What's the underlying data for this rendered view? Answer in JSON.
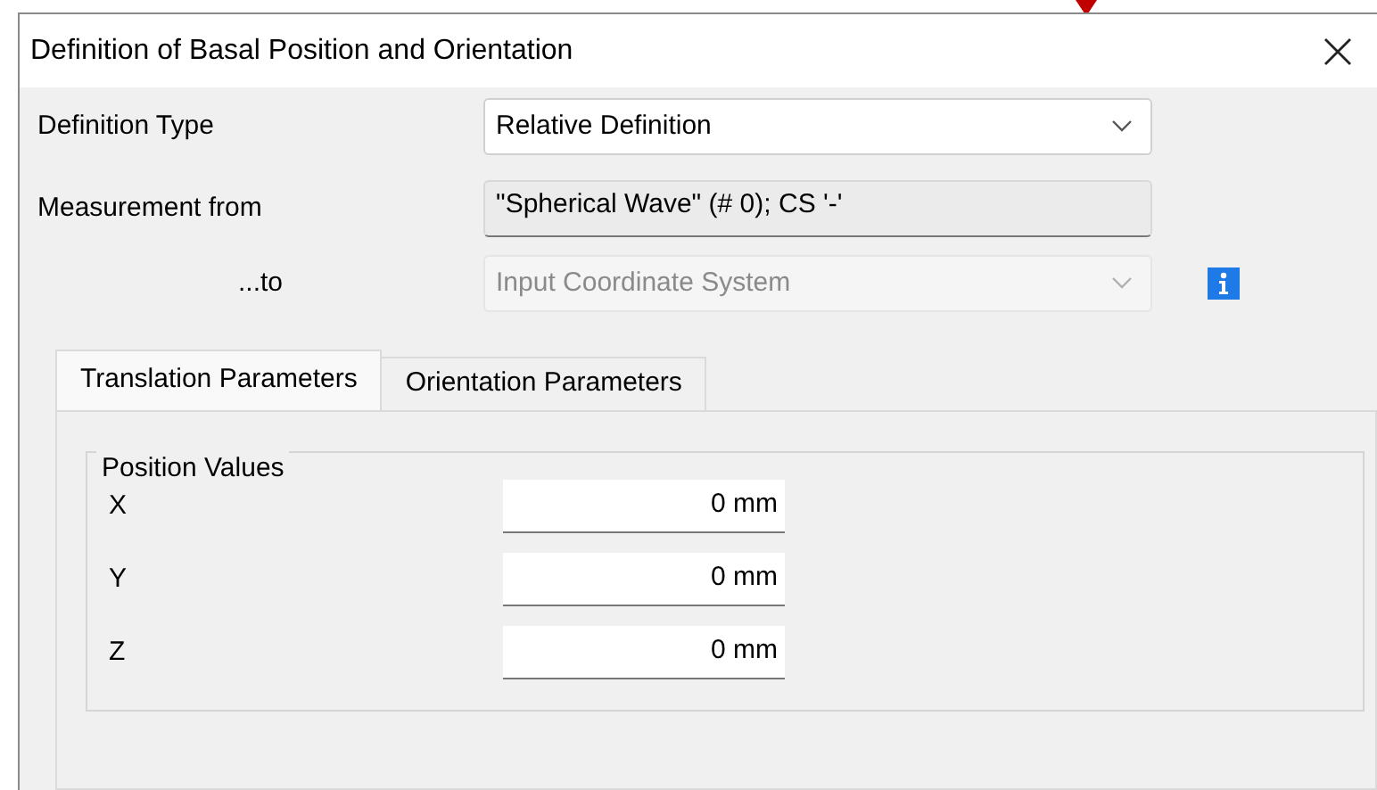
{
  "window": {
    "title": "Definition of Basal Position and Orientation"
  },
  "definition_type": {
    "label": "Definition Type",
    "value": "Relative Definition",
    "disabled": false
  },
  "measurement_from": {
    "label": "Measurement from",
    "value": "\"Spherical Wave\" (# 0); CS '-'"
  },
  "to": {
    "label": "...to",
    "value": "Input Coordinate System",
    "disabled": true
  },
  "tabs": [
    {
      "label": "Translation Parameters",
      "selected": true
    },
    {
      "label": "Orientation Parameters",
      "selected": false
    }
  ],
  "position_values": {
    "title": "Position Values",
    "fields": [
      {
        "label": "X",
        "value": "0 mm"
      },
      {
        "label": "Y",
        "value": "0 mm"
      },
      {
        "label": "Z",
        "value": "0 mm"
      }
    ]
  }
}
